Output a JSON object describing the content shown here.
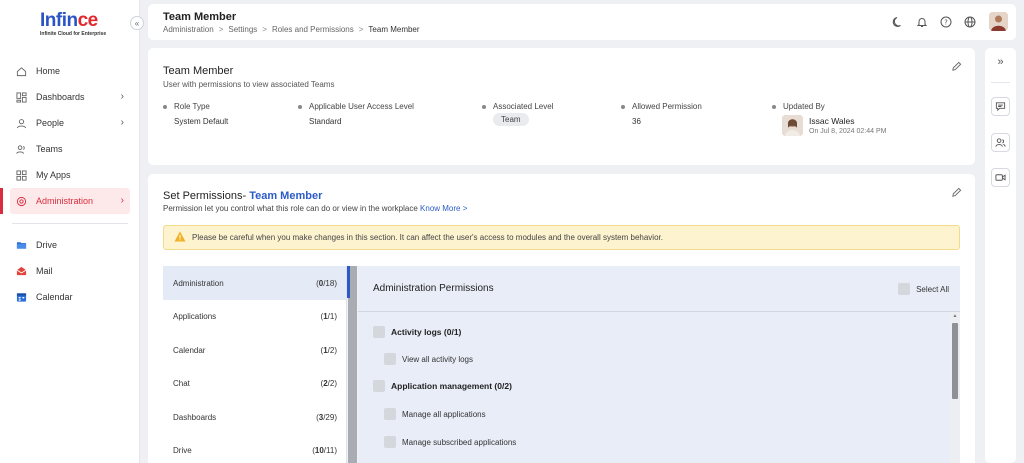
{
  "brand": {
    "name_main": "Infin",
    "name_accent": "ce",
    "tagline": "Infinite Cloud for Enterprise"
  },
  "sidebar": {
    "items": [
      {
        "label": "Home",
        "icon": "home-icon"
      },
      {
        "label": "Dashboards",
        "icon": "dashboard-icon"
      },
      {
        "label": "People",
        "icon": "person-icon"
      },
      {
        "label": "Teams",
        "icon": "teams-icon"
      },
      {
        "label": "My Apps",
        "icon": "apps-icon"
      },
      {
        "label": "Administration",
        "icon": "admin-icon"
      }
    ],
    "apps": [
      {
        "label": "Drive",
        "icon": "drive-icon",
        "color": "#2b6fd6"
      },
      {
        "label": "Mail",
        "icon": "mail-icon",
        "color": "#e0453a"
      },
      {
        "label": "Calendar",
        "icon": "calendar-icon",
        "color": "#2b6fd6"
      }
    ]
  },
  "header": {
    "title": "Team Member",
    "breadcrumb": [
      "Administration",
      "Settings",
      "Roles and Permissions",
      "Team Member"
    ]
  },
  "role_card": {
    "title": "Team Member",
    "subtitle": "User with permissions to view associated Teams",
    "fields": {
      "role_type_label": "Role Type",
      "role_type": "System Default",
      "access_level_label": "Applicable User Access Level",
      "access_level": "Standard",
      "associated_level_label": "Associated Level",
      "associated_level": "Team",
      "allowed_permission_label": "Allowed Permission",
      "allowed_permission": "36",
      "updated_by_label": "Updated By",
      "updated_by_name": "Issac Wales",
      "updated_on": "On Jul 8, 2024 02:44 PM"
    }
  },
  "permissions": {
    "title_prefix": "Set Permissions- ",
    "title_role": "Team Member",
    "description": "Permission let you control what this role can do or view in the workplace",
    "know_more": "Know More >",
    "warning": "Please be careful when you make changes in this section. It can affect the user's access to modules and the overall system behavior.",
    "modules": [
      {
        "name": "Administration",
        "granted": "0",
        "total": "18"
      },
      {
        "name": "Applications",
        "granted": "1",
        "total": "1"
      },
      {
        "name": "Calendar",
        "granted": "1",
        "total": "2"
      },
      {
        "name": "Chat",
        "granted": "2",
        "total": "2"
      },
      {
        "name": "Dashboards",
        "granted": "3",
        "total": "29"
      },
      {
        "name": "Drive",
        "granted": "10",
        "total": "11"
      }
    ],
    "panel_title": "Administration Permissions",
    "select_all": "Select All",
    "groups": [
      {
        "label": "Activity logs (0/1)",
        "items": [
          "View all activity logs"
        ]
      },
      {
        "label": "Application management (0/2)",
        "items": [
          "Manage all applications",
          "Manage subscribed applications"
        ]
      }
    ]
  }
}
